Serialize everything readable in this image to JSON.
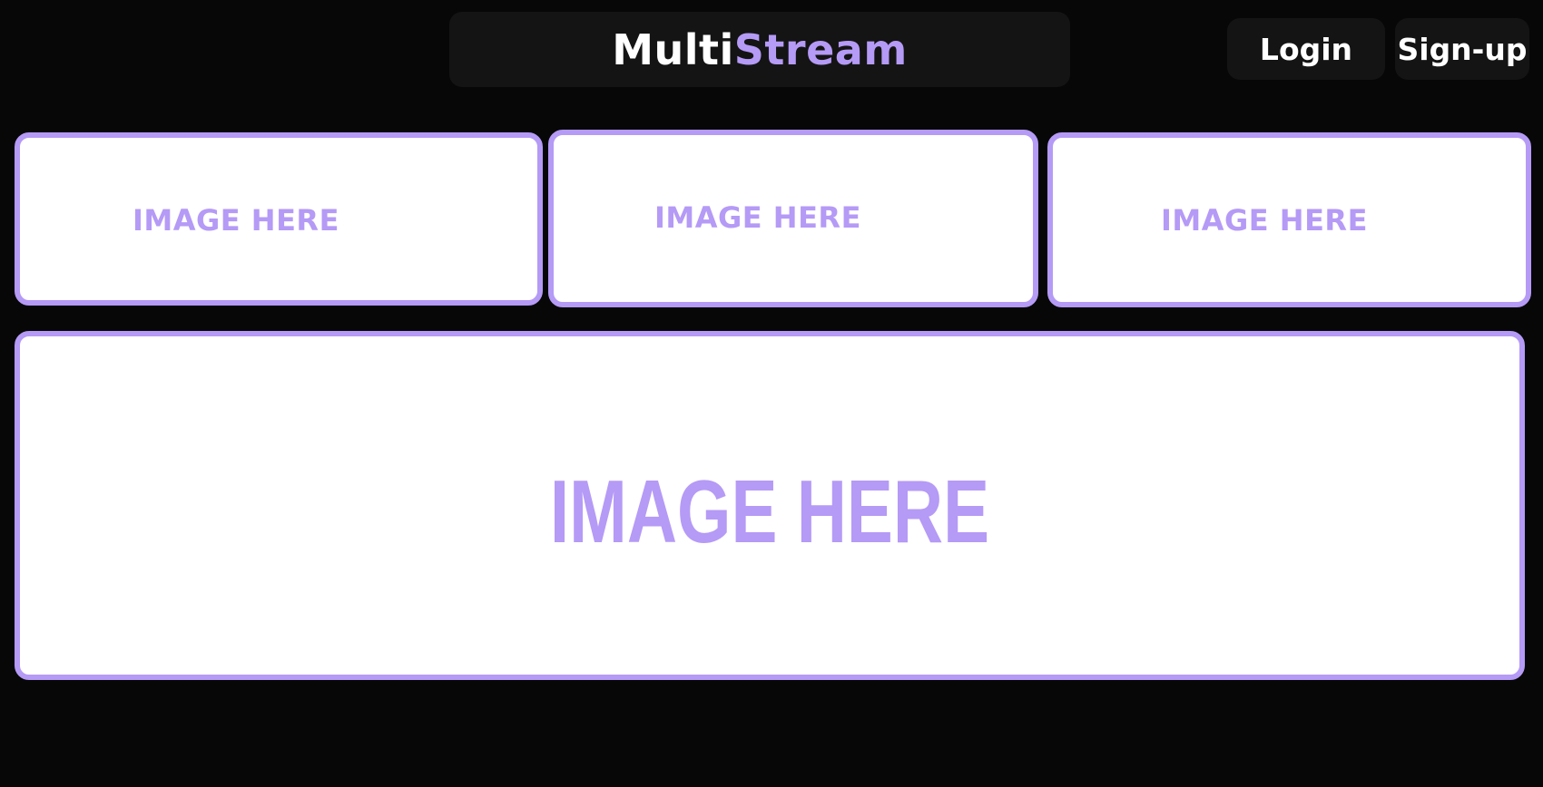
{
  "header": {
    "brand_first": "Multi",
    "brand_second": "Stream",
    "login_label": "Login",
    "signup_label": "Sign-up"
  },
  "thumbnails": [
    {
      "label": "IMAGE HERE"
    },
    {
      "label": "IMAGE HERE"
    },
    {
      "label": "IMAGE HERE"
    }
  ],
  "main_image": {
    "label": "IMAGE HERE"
  },
  "colors": {
    "background": "#070707",
    "panel": "#141414",
    "accent": "#b59af6",
    "text": "#ffffff"
  }
}
